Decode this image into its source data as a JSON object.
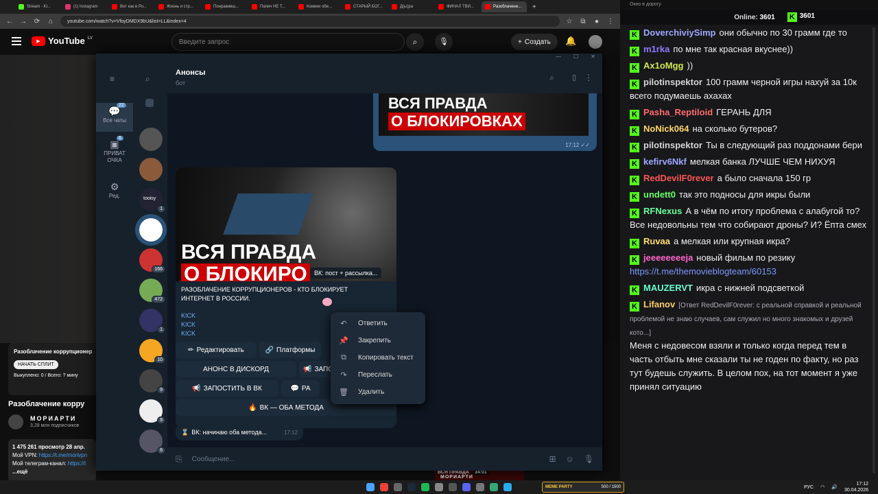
{
  "browser": {
    "tabs": [
      {
        "label": "Stream - Ki...",
        "color": "#53fc18"
      },
      {
        "label": "(1) Instagram",
        "color": "#e1306c"
      },
      {
        "label": "Вот как в Ро...",
        "color": "#ff0000"
      },
      {
        "label": "Жизнь и стр...",
        "color": "#ff0000"
      },
      {
        "label": "Понравивш...",
        "color": "#ff0000"
      },
      {
        "label": "Папич НЕ Т...",
        "color": "#ff0000"
      },
      {
        "label": "Комики обе...",
        "color": "#ff0000"
      },
      {
        "label": "СТАРЫЙ БОГ...",
        "color": "#ff0000"
      },
      {
        "label": "Д(ы)ра",
        "color": "#ff0000"
      },
      {
        "label": "ФИНАЛ ТВИ...",
        "color": "#ff0000"
      },
      {
        "label": "Разоблачени...",
        "color": "#ff0000"
      }
    ],
    "url": "youtube.com/watch?v=VfoyDMDX9bU&list=LL&index=4"
  },
  "youtube": {
    "logo": "YouTube",
    "region": "LV",
    "search_placeholder": "Введите запрос",
    "create_label": "Создать",
    "panel_title": "Разоблачение коррупционер",
    "panel_button": "НАЧАТЬ СПЛИТ",
    "panel_text": "Выкуплено: 0 / Всего: ? мину",
    "video_title": "Разоблачение корру",
    "channel_name": "МОРИАРТИ",
    "subscribers": "3,28 млн подписчиков",
    "desc_line1": "1 475 261 просмотр  28 апр.",
    "desc_line2_prefix": "Мой VPN: ",
    "desc_line2_link": "https://t.me/morivpn",
    "desc_line3_prefix": "Мой телеграм-канал: ",
    "desc_line3_link": "https://t",
    "desc_more": "...ещё",
    "thumb_title": "ВСЯ ПРАВДА",
    "thumb_duration": "34:01",
    "thumb_sub": "О БЛОКИР",
    "thumb_channel": "МОРИАРТИ"
  },
  "telegram": {
    "folders": [
      {
        "label": "Все чаты",
        "count": "22"
      },
      {
        "label": "ПРИВАТ ОЧКА",
        "count": "6"
      },
      {
        "label": "Ред.",
        "count": ""
      }
    ],
    "chats": [
      {
        "badge": ""
      },
      {
        "badge": ""
      },
      {
        "badge": "1",
        "text": "tooisy"
      },
      {
        "badge": ""
      },
      {
        "badge": "166"
      },
      {
        "badge": "472"
      },
      {
        "badge": "1"
      },
      {
        "badge": "10"
      },
      {
        "badge": "9"
      },
      {
        "badge": "9"
      },
      {
        "badge": "6"
      }
    ],
    "chat_title": "Анонсы",
    "chat_subtitle": "бот",
    "banner_line1": "ВСЯ ПРАВДА",
    "banner_line2": "О БЛОКИРОВКАХ",
    "out_time": "17:12",
    "banner2_line1": "ВСЯ ПРАВДА",
    "banner2_line2": "О БЛОКИРО",
    "tooltip": "ВК: пост + рассылка...",
    "post_text": "РАЗОБЛАЧЕНИЕ КОРРУПЦИОНЕРОВ - КТО БЛОКИРУЕТ ИНТЕРНЕТ В РОССИИ.",
    "links": [
      "KICK",
      "KICK",
      "KICK"
    ],
    "buttons": {
      "edit": "Редактировать",
      "platforms": "Платформы",
      "discord": "АНОНС В ДИСКОРД",
      "post": "ЗАПО",
      "vk": "ЗАПОСТИТЬ В ВК",
      "ra": "РА",
      "both": "ВК — ОБА МЕТОДА"
    },
    "status_msg": "ВК: начинаю оба метода...",
    "status_time": "17:12",
    "composer_placeholder": "Сообщение...",
    "context_menu": [
      "Ответить",
      "Закрепить",
      "Копировать текст",
      "Переслать",
      "Удалить"
    ]
  },
  "chat": {
    "window_title": "Окно в дорогу",
    "online_label": "Online:",
    "online_count": "3601",
    "kick_count": "3601",
    "messages": [
      {
        "user": "DoverchiviySimp",
        "color": "#9ea7ff",
        "text": "они обычно по 30 грамм где то"
      },
      {
        "user": "m1rka",
        "color": "#8f7bff",
        "text": "по мне так красная вкуснее))"
      },
      {
        "user": "Ax1oMgg",
        "color": "#cfe94c",
        "text": "))"
      },
      {
        "user": "pilotinspektor",
        "color": "#d5d5d5",
        "text": "100 грамм черной игры нахуй за 10к всего подумаешь ахахах"
      },
      {
        "user": "Pasha_Reptiloid",
        "color": "#ff6b6b",
        "text": "ГЕРАНЬ ДЛЯ"
      },
      {
        "user": "NoNick064",
        "color": "#ffd666",
        "text": "на сколько бутеров?"
      },
      {
        "user": "pilotinspektor",
        "color": "#d5d5d5",
        "text": "Ты в следующий раз поддонами бери"
      },
      {
        "user": "kefirv6Nkf",
        "color": "#9ea7ff",
        "text": "мелкая банка ЛУЧШЕ ЧЕМ НИХУЯ"
      },
      {
        "user": "RedDevilF0rever",
        "color": "#ff5555",
        "text": "а было сначала 150 гр"
      },
      {
        "user": "undett0",
        "color": "#66ff66",
        "text": "так это подносы для икры были"
      },
      {
        "user": "RFNexus",
        "color": "#66ff99",
        "text": "А в чём по итогу проблема с алабугой то? Все недовольны тем что собирают дроны? И? Ёпта смех"
      },
      {
        "user": "Ruvaa",
        "color": "#ffe066",
        "text": "а мелкая или крупная икра?"
      },
      {
        "user": "jeeeeeeeeja",
        "color": "#ff66cc",
        "text": "новый фильм по резику",
        "link": "https://t.me/themovieblogteam/60153"
      },
      {
        "user": "MAUZERVT",
        "color": "#66ffcc",
        "text": "икра с нижней подсветкой"
      },
      {
        "user": "Lifanov",
        "color": "#ffcc66",
        "reply": "[Ответ RedDevilF0rever: с реальной справкой и реальной проблемой не знаю случаев, сам служил но много знакомых и друзей кото...]",
        "text": "Меня с недовесом взяли и только когда перед тем в часть отбыть мне сказали ты не годен по факту, но раз тут будешь служить. В целом пох, на тот момент я уже принял ситуацию"
      }
    ]
  },
  "taskbar": {
    "lang": "РУС",
    "time": "17:12",
    "date": "30.04.2026",
    "widget_title": "MEME PARTY",
    "widget_counter": "500 / 1500"
  }
}
